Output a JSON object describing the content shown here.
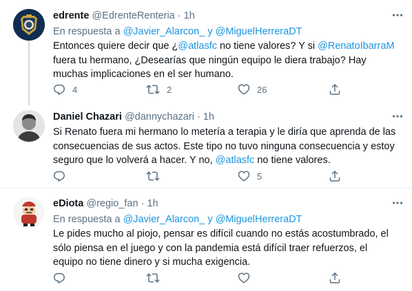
{
  "tweets": [
    {
      "name": "edrente",
      "handle": "@EdrenteRenteria",
      "dot": "·",
      "time": "1h",
      "reply_prefix": "En respuesta a",
      "reply_m1": "@Javier_Alarcon_",
      "reply_and": "y",
      "reply_m2": "@MiguelHerreraDT",
      "l1a": "Entonces quiere decir que ¿",
      "l1m": "@atlasfc",
      "l1b": " no tiene valores? Y si ",
      "l1m2": "@RenatoIbarraM",
      "l2": "fuera tu hermano, ¿Desearías que ningún equipo le diera trabajo? Hay",
      "l3": "muchas implicaciones en el ser humano.",
      "replies": "4",
      "retweets": "2",
      "likes": "26"
    },
    {
      "name": "Daniel Chazari",
      "handle": "@dannychazari",
      "dot": "·",
      "time": "1h",
      "l1": "Si Renato fuera mi hermano lo metería a terapia y le diría que aprenda de las",
      "l2": "consecuencias de sus actos. Este tipo no tuvo ninguna consecuencia y estoy",
      "l3a": "seguro que lo volverá a hacer. Y no, ",
      "l3m": "@atlasfc",
      "l3b": " no tiene valores.",
      "likes": "5"
    },
    {
      "name": "eDiota",
      "handle": "@regio_fan",
      "dot": "·",
      "time": "1h",
      "reply_prefix": "En respuesta a",
      "reply_m1": "@Javier_Alarcon_",
      "reply_and": "y",
      "reply_m2": "@MiguelHerreraDT",
      "l1": "Le pides mucho al piojo, pensar es difícil cuando no estás acostumbrado, el",
      "l2": "sólo piensa en el juego y con la pandemia está difícil traer refuerzos, el",
      "l3": "equipo no tiene dinero y si mucha exigencia."
    }
  ],
  "colors": {
    "accent": "#1b95e0",
    "muted": "#5b7083",
    "text": "#0f1419",
    "divider": "#e6ecf0"
  },
  "icons": [
    "reply-icon",
    "retweet-icon",
    "like-icon",
    "share-icon",
    "more-icon"
  ]
}
